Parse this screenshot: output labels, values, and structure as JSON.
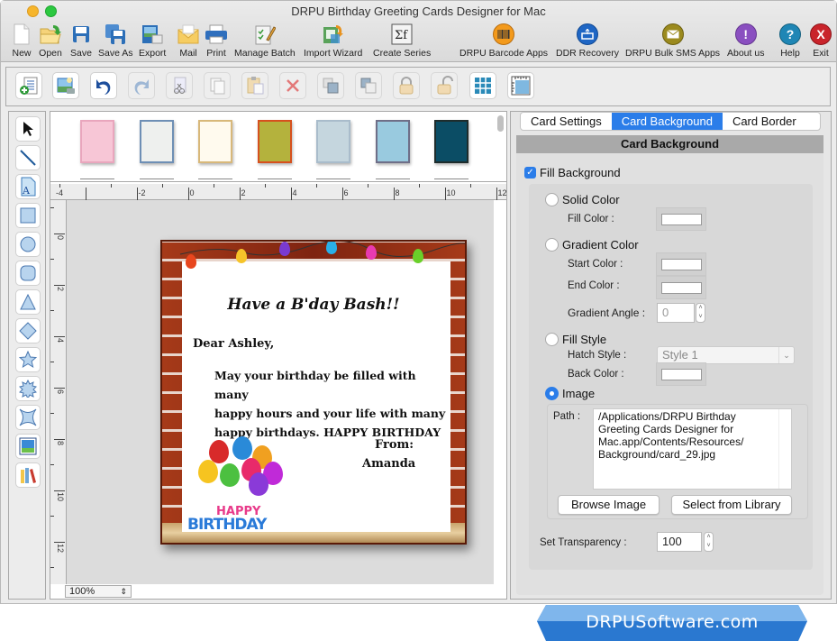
{
  "window": {
    "title": "DRPU Birthday Greeting Cards Designer for Mac"
  },
  "main_toolbar": [
    {
      "label": "New",
      "icon": "new-document-icon"
    },
    {
      "label": "Open",
      "icon": "open-folder-icon"
    },
    {
      "label": "Save",
      "icon": "save-icon"
    },
    {
      "label": "Save As",
      "icon": "save-as-icon"
    },
    {
      "label": "Export",
      "icon": "export-icon"
    },
    {
      "label": "Mail",
      "icon": "mail-icon"
    },
    {
      "label": "Print",
      "icon": "printer-icon"
    },
    {
      "label": "Manage Batch",
      "icon": "manage-batch-icon"
    },
    {
      "label": "Import Wizard",
      "icon": "import-wizard-icon"
    },
    {
      "label": "Create Series",
      "icon": "sigma-function-icon"
    },
    {
      "label": "DRPU Barcode Apps",
      "icon": "barcode-icon",
      "color": "#f39a1c"
    },
    {
      "label": "DDR Recovery",
      "icon": "recovery-icon",
      "color": "#1f66c4"
    },
    {
      "label": "DRPU Bulk SMS Apps",
      "icon": "envelope-icon",
      "color": "#9b8a1e"
    },
    {
      "label": "About us",
      "icon": "exclamation-icon",
      "color": "#8a4fc0"
    },
    {
      "label": "Help",
      "icon": "question-icon",
      "color": "#1f86b5"
    },
    {
      "label": "Exit",
      "icon": "exit-x-icon",
      "color": "#c9242b"
    }
  ],
  "edit_toolbar": [
    {
      "name": "add-text-icon",
      "enabled": true
    },
    {
      "name": "insert-image-icon",
      "enabled": true
    },
    {
      "name": "undo-icon",
      "enabled": true
    },
    {
      "name": "redo-icon",
      "enabled": false
    },
    {
      "name": "cut-icon",
      "enabled": false
    },
    {
      "name": "copy-icon",
      "enabled": false
    },
    {
      "name": "paste-icon",
      "enabled": false
    },
    {
      "name": "delete-icon",
      "enabled": false
    },
    {
      "name": "bring-front-icon",
      "enabled": false
    },
    {
      "name": "send-back-icon",
      "enabled": false
    },
    {
      "name": "lock-icon",
      "enabled": false
    },
    {
      "name": "unlock-icon",
      "enabled": false
    },
    {
      "name": "grid-icon",
      "enabled": true
    },
    {
      "name": "ruler-icon",
      "enabled": true
    }
  ],
  "tools": [
    "pointer",
    "line",
    "text",
    "rectangle",
    "ellipse",
    "rounded-rectangle",
    "triangle",
    "diamond",
    "star",
    "burst",
    "concave-star",
    "image",
    "library"
  ],
  "templates": [
    {
      "color": "#f7c6d6",
      "border": "#e9a6bd"
    },
    {
      "color": "#eef0ee",
      "border": "#6e8fb5"
    },
    {
      "color": "#fffaee",
      "border": "#d8b87a"
    },
    {
      "color": "#b4b23d",
      "border": "#d6501e"
    },
    {
      "color": "#c5d6de",
      "border": "#a9bccb"
    },
    {
      "color": "#99cadf",
      "border": "#6f6f88"
    },
    {
      "color": "#0b4d65",
      "border": "#1e2c2c"
    }
  ],
  "ruler": {
    "h_labels": [
      "-4",
      "-2",
      "0",
      "2",
      "4",
      "6",
      "8",
      "10",
      "12"
    ],
    "v_labels": [
      "0",
      "2",
      "4",
      "6",
      "8",
      "10",
      "12"
    ]
  },
  "zoom": {
    "value": "100%"
  },
  "card": {
    "title": "Have a B'day Bash!!",
    "greeting": "Dear Ashley,",
    "body_lines": [
      "May your birthday be filled with many",
      "happy hours and your life with many",
      "happy birthdays. HAPPY BIRTHDAY !!"
    ],
    "from_label": "From:",
    "from_name": "Amanda",
    "art_text_top": "HAPPY",
    "art_text_bottom": "BIRTHDAY"
  },
  "panel": {
    "tabs": [
      {
        "label": "Card Settings",
        "active": false
      },
      {
        "label": "Card Background",
        "active": true
      },
      {
        "label": "Card Border",
        "active": false
      }
    ],
    "section_title": "Card Background",
    "fill_background": {
      "label": "Fill Background",
      "checked": true
    },
    "solid_color": {
      "label": "Solid Color",
      "selected": false,
      "fill_color_label": "Fill Color :",
      "fill_color": "#ffffff"
    },
    "gradient_color": {
      "label": "Gradient Color",
      "selected": false,
      "start_label": "Start Color :",
      "start_color": "#ffffff",
      "end_label": "End Color :",
      "end_color": "#ffffff",
      "angle_label": "Gradient Angle :",
      "angle_value": "0"
    },
    "fill_style": {
      "label": "Fill Style",
      "selected": false,
      "hatch_label": "Hatch Style :",
      "hatch_value": "Style 1",
      "back_color_label": "Back Color :",
      "back_color": "#ffffff"
    },
    "image": {
      "label": "Image",
      "selected": true,
      "path_label": "Path :",
      "path_value": "/Applications/DRPU Birthday Greeting Cards Designer for Mac.app/Contents/Resources/Background/card_29.jpg",
      "path_lines": [
        "/Applications/DRPU Birthday",
        "Greeting Cards Designer for",
        "Mac.app/Contents/Resources/",
        "Background/card_29.jpg"
      ],
      "browse_label": "Browse Image",
      "library_label": "Select from Library"
    },
    "transparency": {
      "label": "Set Transparency :",
      "value": "100"
    }
  },
  "banner": {
    "text": "DRPUSoftware.com"
  }
}
